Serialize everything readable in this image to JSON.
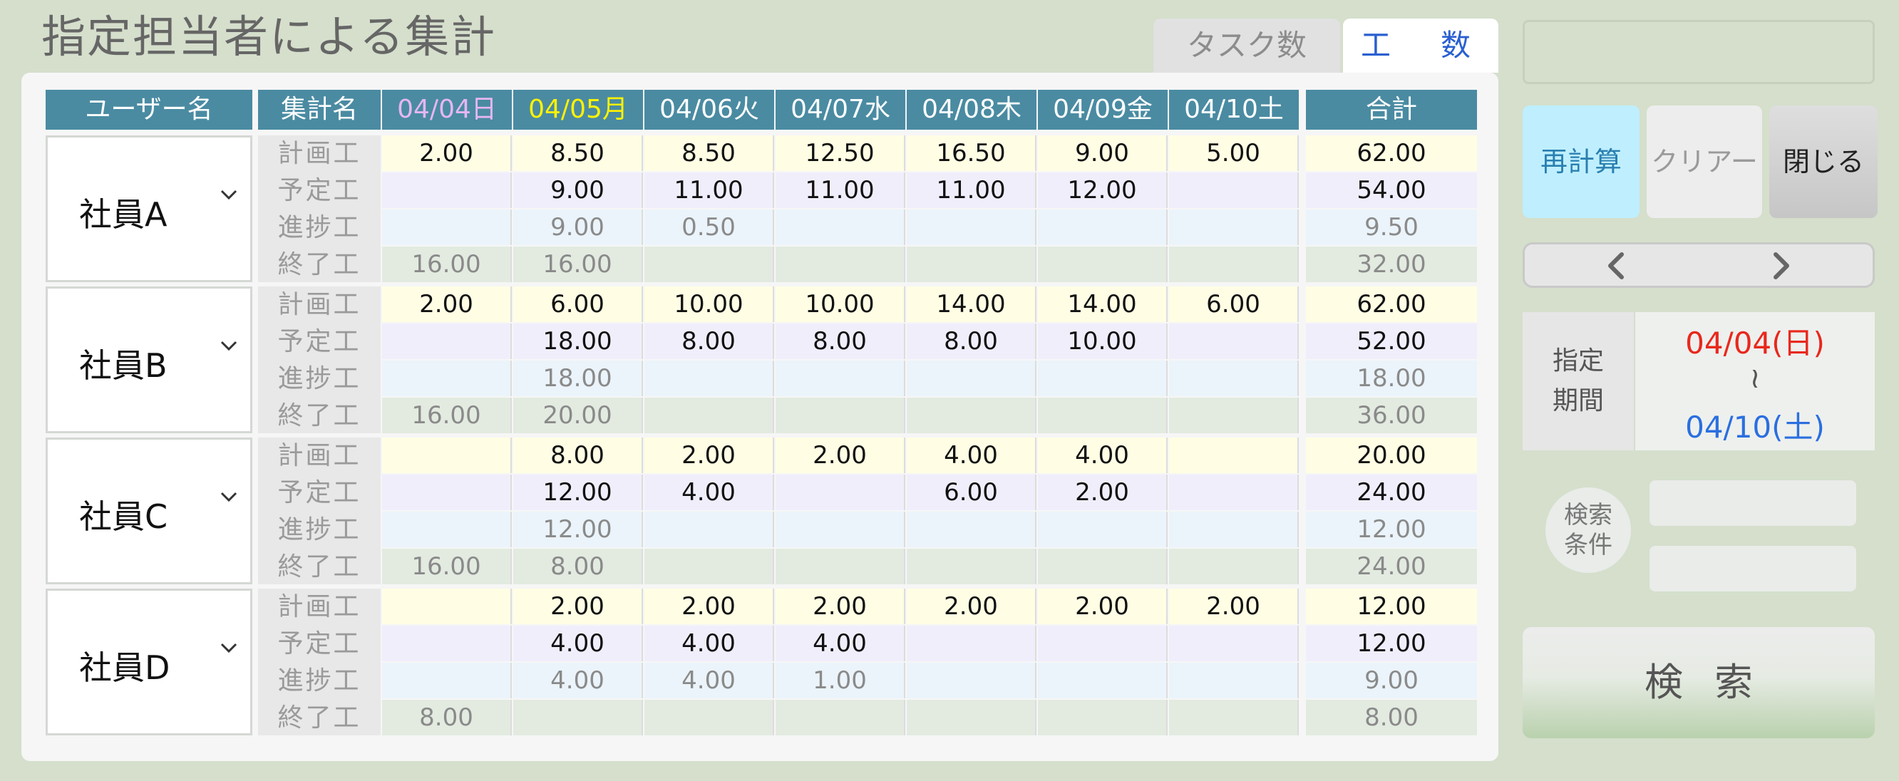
{
  "page_title": "指定担当者による集計",
  "tabs": [
    "タスク数",
    "工　数"
  ],
  "headers": {
    "user": "ユーザー名",
    "kind": "集計名",
    "dates": [
      "04/04日",
      "04/05月",
      "04/06火",
      "04/07水",
      "04/08木",
      "04/09金",
      "04/10土"
    ],
    "total": "合計"
  },
  "colors": {
    "header_bg": "#4a8ba2",
    "sunday_header": "#e6b7f0",
    "today_header": "#fff200",
    "start_date": "#e8281c",
    "end_date": "#2a6fe0"
  },
  "kinds": [
    "計画工",
    "予定工",
    "進捗工",
    "終了工"
  ],
  "groups": [
    {
      "user": "社員A",
      "rows": [
        [
          "2.00",
          "8.50",
          "8.50",
          "12.50",
          "16.50",
          "9.00",
          "5.00",
          "62.00"
        ],
        [
          "",
          "9.00",
          "11.00",
          "11.00",
          "11.00",
          "12.00",
          "",
          "54.00"
        ],
        [
          "",
          "9.00",
          "0.50",
          "",
          "",
          "",
          "",
          "9.50"
        ],
        [
          "16.00",
          "16.00",
          "",
          "",
          "",
          "",
          "",
          "32.00"
        ]
      ]
    },
    {
      "user": "社員B",
      "rows": [
        [
          "2.00",
          "6.00",
          "10.00",
          "10.00",
          "14.00",
          "14.00",
          "6.00",
          "62.00"
        ],
        [
          "",
          "18.00",
          "8.00",
          "8.00",
          "8.00",
          "10.00",
          "",
          "52.00"
        ],
        [
          "",
          "18.00",
          "",
          "",
          "",
          "",
          "",
          "18.00"
        ],
        [
          "16.00",
          "20.00",
          "",
          "",
          "",
          "",
          "",
          "36.00"
        ]
      ]
    },
    {
      "user": "社員C",
      "rows": [
        [
          "",
          "8.00",
          "2.00",
          "2.00",
          "4.00",
          "4.00",
          "",
          "20.00"
        ],
        [
          "",
          "12.00",
          "4.00",
          "",
          "6.00",
          "2.00",
          "",
          "24.00"
        ],
        [
          "",
          "12.00",
          "",
          "",
          "",
          "",
          "",
          "12.00"
        ],
        [
          "16.00",
          "8.00",
          "",
          "",
          "",
          "",
          "",
          "24.00"
        ]
      ]
    },
    {
      "user": "社員D",
      "rows": [
        [
          "",
          "2.00",
          "2.00",
          "2.00",
          "2.00",
          "2.00",
          "2.00",
          "12.00"
        ],
        [
          "",
          "4.00",
          "4.00",
          "4.00",
          "",
          "",
          "",
          "12.00"
        ],
        [
          "",
          "4.00",
          "4.00",
          "1.00",
          "",
          "",
          "",
          "9.00"
        ],
        [
          "8.00",
          "",
          "",
          "",
          "",
          "",
          "",
          "8.00"
        ]
      ]
    }
  ],
  "buttons": {
    "recalc": "再計算",
    "clear": "クリアー",
    "close": "閉じる",
    "search": "検索"
  },
  "period": {
    "label_line1": "指定",
    "label_line2": "期間",
    "start": "04/04(日)",
    "sep": "≀",
    "end": "04/10(土)"
  },
  "search_cond": {
    "label_line1": "検索",
    "label_line2": "条件",
    "value1": "",
    "value2": ""
  }
}
